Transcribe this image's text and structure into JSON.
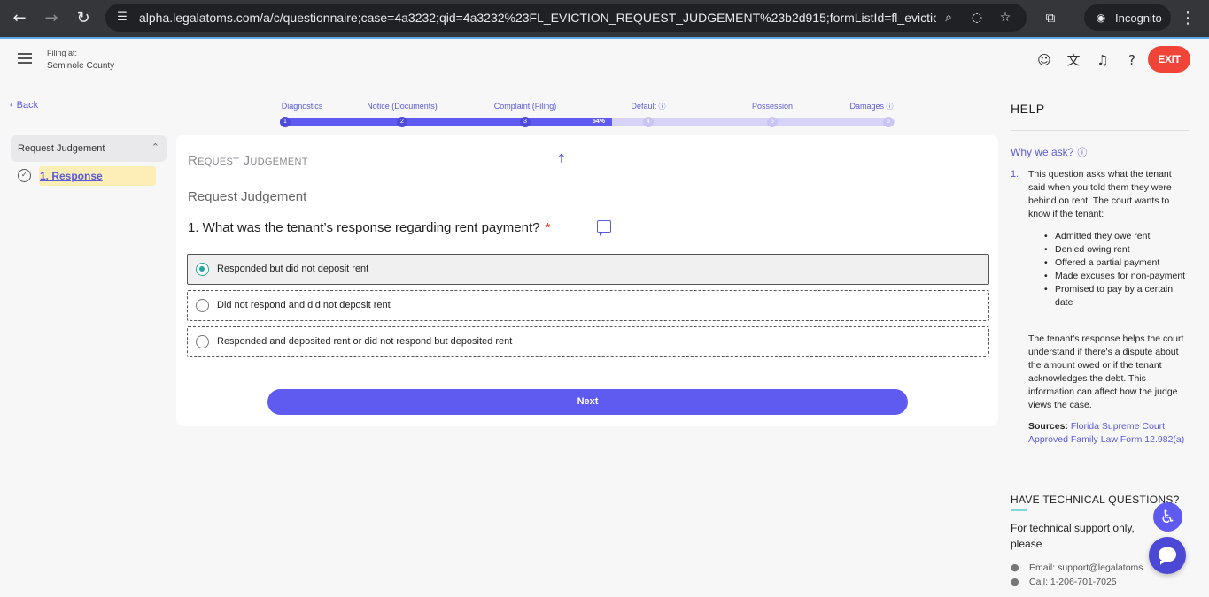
{
  "browser": {
    "url": "alpha.legalatoms.com/a/c/questionnaire;case=4a3232;qid=4a3232%23FL_EVICTION_REQUEST_JUDGEMENT%23b2d915;formListId=fl_eviction_j...",
    "profile_label": "Incognito",
    "icons": {
      "back": "arrow-left-icon",
      "forward": "arrow-right-icon",
      "reload": "reload-icon",
      "site_info": "tune-icon",
      "zoom": "zoom-icon",
      "eye_off": "eye-off-icon",
      "bookmark": "star-icon",
      "extensions": "puzzle-icon",
      "menu": "kebab-icon"
    }
  },
  "header": {
    "filing_label": "Filing at:",
    "county": "Seminole County",
    "exit_label": "EXIT",
    "exit_color": "#f04438",
    "icons": [
      "account-icon",
      "translate-icon",
      "notification-icon",
      "help-icon"
    ]
  },
  "nav": {
    "back_label": "Back",
    "section_title": "Request Judgement",
    "steps": [
      {
        "label": "1. Response",
        "active": true
      }
    ]
  },
  "progress": {
    "stages": [
      {
        "label": "Diagnostics",
        "number": "1",
        "info": false
      },
      {
        "label": "Notice (Documents)",
        "number": "2",
        "info": false
      },
      {
        "label": "Complaint (Filing)",
        "number": "3",
        "info": false
      },
      {
        "label": "Default",
        "number": "4",
        "info": true
      },
      {
        "label": "Possession",
        "number": "5",
        "info": false
      },
      {
        "label": "Damages",
        "number": "6",
        "info": true
      }
    ],
    "percent_label": "54%",
    "percent": 54,
    "accent": "#5f5bf0"
  },
  "main": {
    "card_title": "Request Judgement",
    "section_subtitle": "Request Judgement",
    "question": "1. What was the tenant’s response regarding rent payment?",
    "required_mark": "*",
    "options": [
      {
        "label": "Responded but did not deposit rent",
        "selected": true
      },
      {
        "label": "Did not respond and did not deposit rent",
        "selected": false
      },
      {
        "label": "Responded and deposited rent or did not respond but deposited rent",
        "selected": false
      }
    ],
    "next_label": "Next"
  },
  "help": {
    "title": "HELP",
    "why_label": "Why we ask?",
    "number": "1.",
    "intro": "This question asks what the tenant said when you told them they were behind on rent. The court wants to know if the tenant:",
    "bullets": [
      "Admitted they owe rent",
      "Denied owing rent",
      "Offered a partial payment",
      "Made excuses for non-payment",
      "Promised to pay by a certain date"
    ],
    "explanation": "The tenant's response helps the court understand if there's a dispute about the amount owed or if the tenant acknowledges the debt. This information can affect how the judge views the case.",
    "sources_label": "Sources:",
    "sources_link": "Florida Supreme Court Approved Family Law Form 12.982(a)",
    "tech_title": "HAVE TECHNICAL QUESTIONS?",
    "tech_body": "For technical support only, please",
    "email_line": "Email: support@legalatoms.",
    "call_line": "Call: 1-206-701-7025"
  }
}
